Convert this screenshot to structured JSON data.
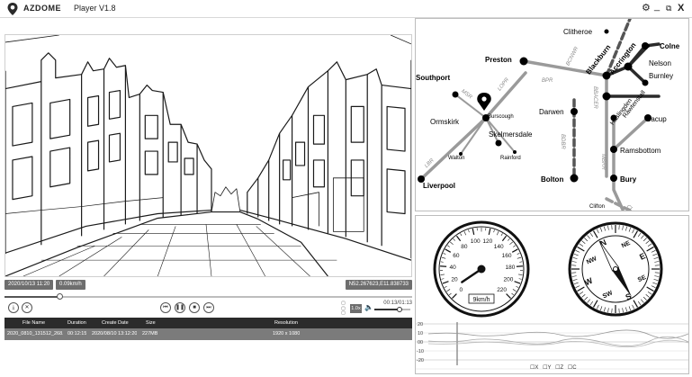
{
  "app": {
    "brand": "AZDOME",
    "version": "Player V1.8",
    "icons": [
      "pin-logo-icon",
      "gear-icon",
      "minimize-icon",
      "restore-icon",
      "close-icon"
    ]
  },
  "video": {
    "datetime": "2020/10/13 11:20",
    "speed": "0.09km/h",
    "coords": "N52.267623,E11.838733",
    "elapsed": "00:13/01:13",
    "progress": 0.135,
    "volume": 0.7,
    "playback_speed": "1.0x"
  },
  "file_table": {
    "headers": [
      "File Name",
      "Duration",
      "Create Date",
      "Size",
      "Resolution"
    ],
    "rows": [
      [
        "2020_0810_131512_268...",
        "00:12:15",
        "2020/08/10 13:12:20",
        "227MB",
        "1920 x 1080"
      ]
    ]
  },
  "map": {
    "places": {
      "clitheroe": "Clitheroe",
      "colne": "Colne",
      "preston": "Preston",
      "blackburn": "Blackburn",
      "accrington": "Accrington",
      "nelson": "Nelson",
      "burnley": "Burnley",
      "southport": "Southport",
      "burscough": "Burscough",
      "darwen": "Darwen",
      "haslingden": "Haslingden",
      "rawtenstall": "Rawtenstall",
      "bacup": "Bacup",
      "ormskirk": "Ormskirk",
      "skelmersdale": "Skelmersdale",
      "walton": "Walton",
      "rainford": "Rainford",
      "ramsbottom": "Ramsbottom",
      "bolton": "Bolton",
      "bury": "Bury",
      "liverpool": "Liverpool",
      "clifton": "Clifton"
    },
    "routes": {
      "bcnwr": "BCNWR",
      "bpr": "BPR",
      "lopr": "LOPR",
      "msr": "MSR",
      "bbacer": "BBACER",
      "bdbr": "BDBR",
      "lbr": "LBR",
      "mbrr": "MBRR",
      "cl": "Cl"
    }
  },
  "speedometer": {
    "unit": "9km/h",
    "ticks": [
      "0",
      "20",
      "40",
      "60",
      "80",
      "100",
      "120",
      "140",
      "160",
      "180",
      "200",
      "220"
    ],
    "value": 9
  },
  "compass": {
    "cardinals": {
      "n": "N",
      "s": "S",
      "e": "E",
      "w": "W"
    },
    "intercardinals": {
      "nw": "NW",
      "ne": "NE",
      "sw": "SW",
      "se": "SE"
    },
    "heading": 150
  },
  "gsensor": {
    "y_ticks": [
      "20",
      "10",
      "00",
      "-10",
      "-20"
    ],
    "axes": [
      "X",
      "Y",
      "Z",
      "C"
    ]
  }
}
